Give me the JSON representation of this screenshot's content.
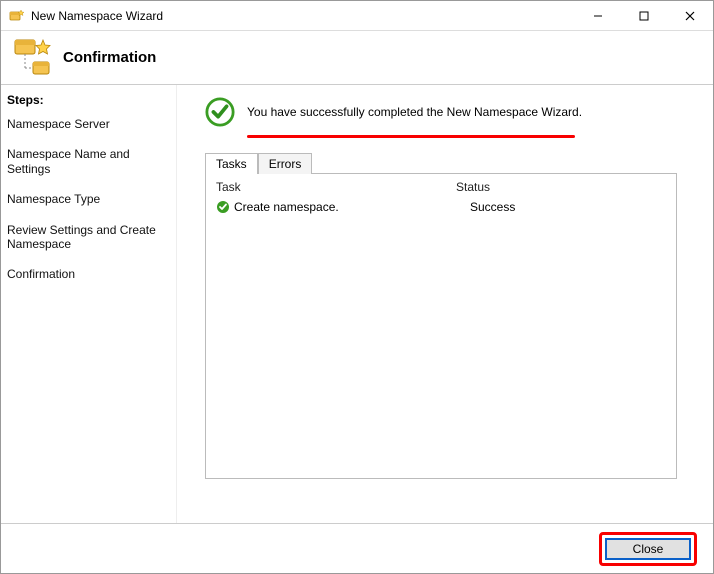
{
  "window": {
    "title": "New Namespace Wizard"
  },
  "header": {
    "title": "Confirmation"
  },
  "sidebar": {
    "label": "Steps:",
    "items": [
      {
        "label": "Namespace Server"
      },
      {
        "label": "Namespace Name and Settings"
      },
      {
        "label": "Namespace Type"
      },
      {
        "label": "Review Settings and Create Namespace"
      },
      {
        "label": "Confirmation"
      }
    ]
  },
  "main": {
    "success_text": "You have successfully completed the New Namespace Wizard.",
    "tabs": [
      {
        "label": "Tasks"
      },
      {
        "label": "Errors"
      }
    ],
    "columns": {
      "task": "Task",
      "status": "Status"
    },
    "rows": [
      {
        "task": "Create namespace.",
        "status": "Success"
      }
    ]
  },
  "footer": {
    "close_label": "Close"
  }
}
